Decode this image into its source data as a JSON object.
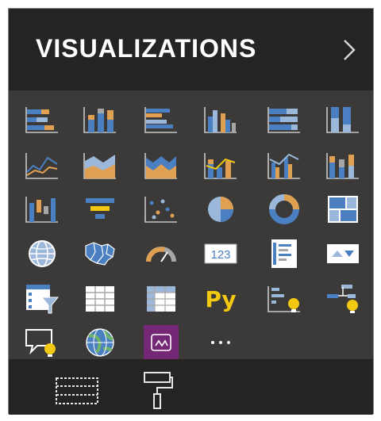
{
  "pane": {
    "title": "VISUALIZATIONS",
    "collapse_icon": "chevron-right-icon"
  },
  "visuals": [
    {
      "name": "stacked-bar-chart-icon"
    },
    {
      "name": "stacked-column-chart-icon"
    },
    {
      "name": "clustered-bar-chart-icon"
    },
    {
      "name": "clustered-column-chart-icon"
    },
    {
      "name": "100-percent-stacked-bar-chart-icon"
    },
    {
      "name": "100-percent-stacked-column-chart-icon"
    },
    {
      "name": "line-chart-icon"
    },
    {
      "name": "area-chart-icon"
    },
    {
      "name": "stacked-area-chart-icon"
    },
    {
      "name": "line-and-stacked-column-chart-icon"
    },
    {
      "name": "line-and-clustered-column-chart-icon"
    },
    {
      "name": "ribbon-chart-icon"
    },
    {
      "name": "waterfall-chart-icon"
    },
    {
      "name": "funnel-icon"
    },
    {
      "name": "scatter-chart-icon"
    },
    {
      "name": "pie-chart-icon"
    },
    {
      "name": "donut-chart-icon"
    },
    {
      "name": "treemap-icon"
    },
    {
      "name": "map-icon"
    },
    {
      "name": "filled-map-icon"
    },
    {
      "name": "gauge-icon"
    },
    {
      "name": "card-icon"
    },
    {
      "name": "multi-row-card-icon"
    },
    {
      "name": "kpi-icon"
    },
    {
      "name": "slicer-icon"
    },
    {
      "name": "table-icon"
    },
    {
      "name": "matrix-icon"
    },
    {
      "name": "python-visual-icon",
      "label": "Py"
    },
    {
      "name": "key-influencers-icon"
    },
    {
      "name": "decomposition-tree-icon"
    },
    {
      "name": "qa-icon"
    },
    {
      "name": "arcgis-map-icon"
    },
    {
      "name": "power-apps-icon"
    },
    {
      "name": "more-visuals-icon",
      "label": "..."
    }
  ],
  "card_value": "123",
  "tools": [
    {
      "name": "fields-tab-icon"
    },
    {
      "name": "format-paint-roller-icon"
    }
  ],
  "colors": {
    "pane_bg": "#252423",
    "grid_bg": "#3b3a39",
    "blue": "#4a7fc1",
    "light_blue": "#9bb7d9",
    "orange": "#e0a052",
    "gray": "#a6a6a6",
    "yellow": "#f2c811",
    "purple": "#742774"
  }
}
